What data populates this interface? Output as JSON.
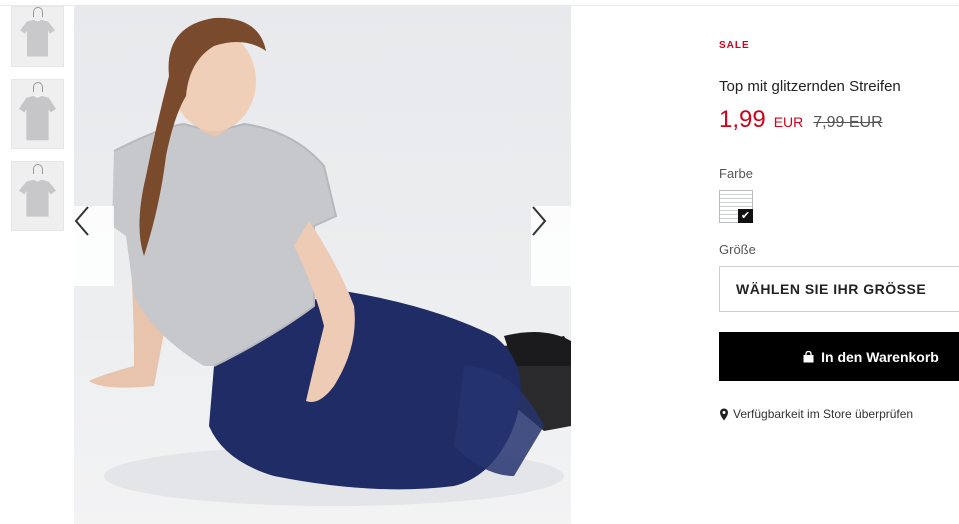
{
  "gallery": {
    "thumbnails": [
      {
        "name": "thumb-1"
      },
      {
        "name": "thumb-2"
      },
      {
        "name": "thumb-3"
      }
    ],
    "prev_icon": "chevron-left-icon",
    "next_icon": "chevron-right-icon"
  },
  "product": {
    "badge": "SALE",
    "title": "Top mit glitzernden Streifen",
    "price_now": "1,99",
    "currency": "EUR",
    "price_old": "7,99 EUR",
    "color_label": "Farbe",
    "size_label": "Größe",
    "size_select": "WÄHLEN SIE IHR GRÖSSE",
    "cart_button": "In den Warenkorb",
    "store_link": "Verfügbarkeit im Store überprüfen"
  },
  "colors": {
    "sale_red": "#d0021b",
    "button_black": "#000000"
  }
}
